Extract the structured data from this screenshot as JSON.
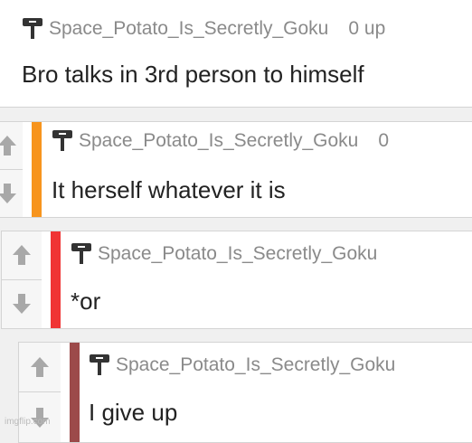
{
  "comments": [
    {
      "username": "Space_Potato_Is_Secretly_Goku",
      "points": "0 up",
      "text": "Bro talks in 3rd person to himself",
      "bar_color": ""
    },
    {
      "username": "Space_Potato_Is_Secretly_Goku",
      "points": "0",
      "text": "It herself whatever it is",
      "bar_color": "#f7941d"
    },
    {
      "username": "Space_Potato_Is_Secretly_Goku",
      "points": "",
      "text": "*or",
      "bar_color": "#f03434"
    },
    {
      "username": "Space_Potato_Is_Secretly_Goku",
      "points": "",
      "text": "I give up",
      "bar_color": "#9c4a4a"
    }
  ],
  "icons": {
    "upvote": "up-arrow-icon",
    "downvote": "down-arrow-icon",
    "user": "user-badge-icon"
  },
  "watermark": "imgflip.com"
}
